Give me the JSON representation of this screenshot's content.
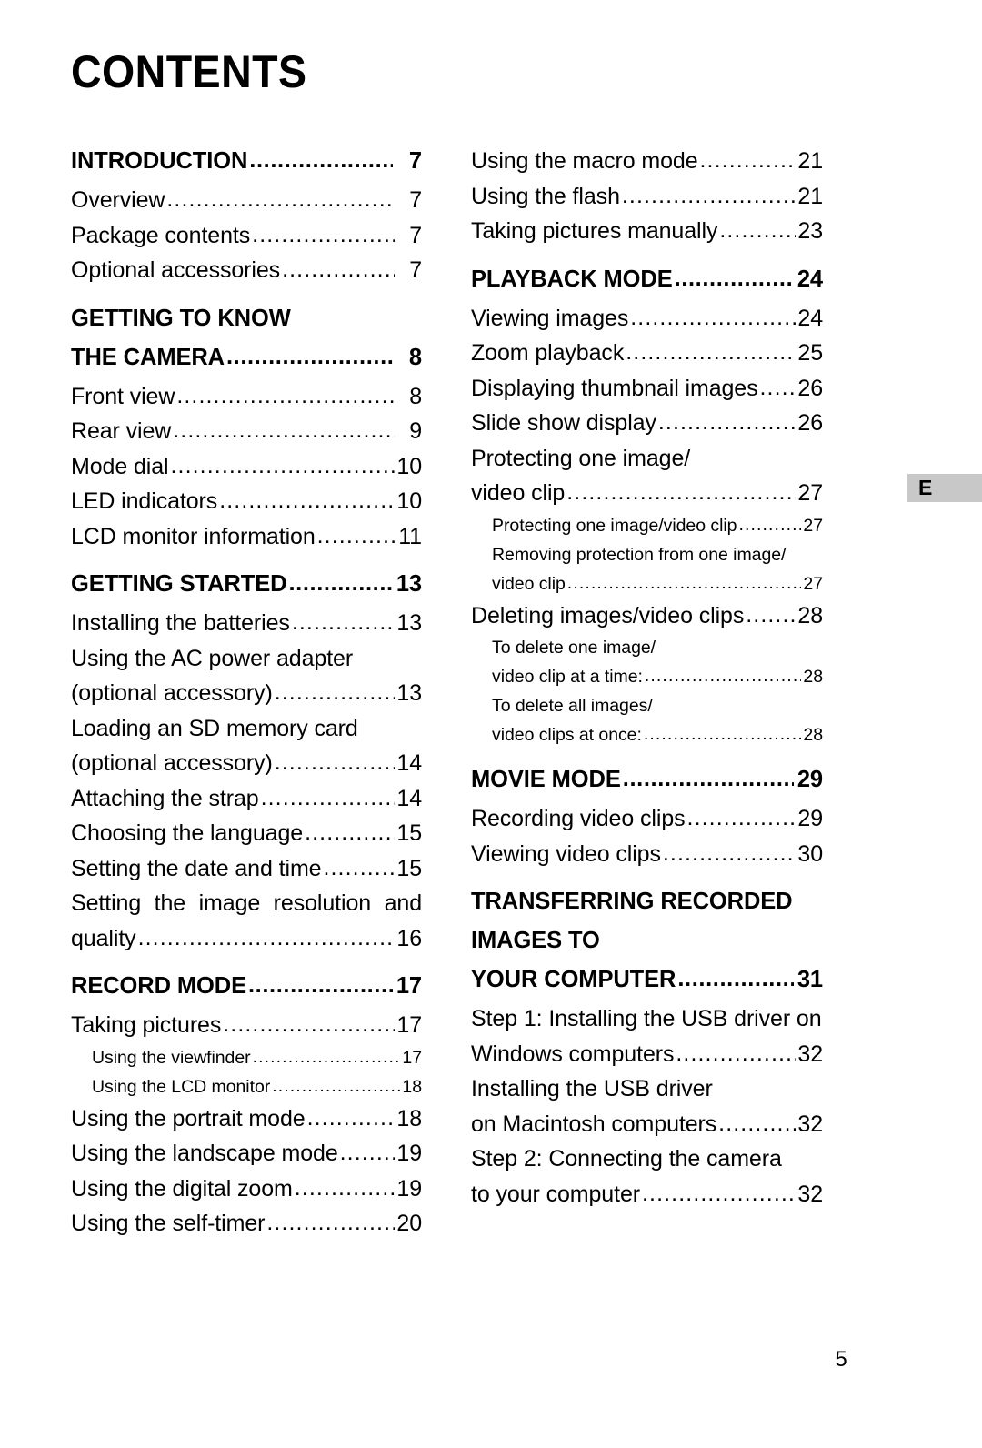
{
  "document": {
    "title": "CONTENTS",
    "folio": "5",
    "edge_tab_letter": "E",
    "leader_char": "."
  },
  "columns": [
    {
      "name": "left",
      "entries": [
        {
          "level": "head",
          "lines": [
            {
              "text": "INTRODUCTION",
              "page": "7"
            }
          ],
          "gap": "none"
        },
        {
          "level": "item",
          "lines": [
            {
              "text": "Overview",
              "page": "7"
            }
          ],
          "gap": "none"
        },
        {
          "level": "item",
          "lines": [
            {
              "text": "Package contents",
              "page": "7"
            }
          ],
          "gap": "none"
        },
        {
          "level": "item",
          "lines": [
            {
              "text": "Optional accessories",
              "page": "7"
            }
          ],
          "gap": "none"
        },
        {
          "level": "head",
          "lines": [
            {
              "text": "GETTING TO KNOW",
              "page": ""
            },
            {
              "text": "THE CAMERA",
              "page": "8"
            }
          ],
          "gap": "before"
        },
        {
          "level": "item",
          "lines": [
            {
              "text": "Front view",
              "page": "8"
            }
          ],
          "gap": "none"
        },
        {
          "level": "item",
          "lines": [
            {
              "text": "Rear view",
              "page": "9"
            }
          ],
          "gap": "none"
        },
        {
          "level": "item",
          "lines": [
            {
              "text": "Mode dial",
              "page": "10"
            }
          ],
          "gap": "none"
        },
        {
          "level": "item",
          "lines": [
            {
              "text": "LED indicators",
              "page": "10"
            }
          ],
          "gap": "none"
        },
        {
          "level": "item",
          "lines": [
            {
              "text": "LCD monitor information",
              "page": "11"
            }
          ],
          "gap": "none"
        },
        {
          "level": "head",
          "lines": [
            {
              "text": "GETTING STARTED",
              "page": "13"
            }
          ],
          "gap": "before"
        },
        {
          "level": "item",
          "lines": [
            {
              "text": "Installing the batteries",
              "page": "13"
            }
          ],
          "gap": "none"
        },
        {
          "level": "item",
          "lines": [
            {
              "text": "Using the AC power adapter",
              "page": ""
            },
            {
              "text": "(optional accessory)",
              "page": "13"
            }
          ],
          "gap": "none"
        },
        {
          "level": "item",
          "lines": [
            {
              "text": "Loading an SD memory card",
              "page": ""
            },
            {
              "text": "(optional accessory)",
              "page": "14"
            }
          ],
          "gap": "none"
        },
        {
          "level": "item",
          "lines": [
            {
              "text": "Attaching the strap",
              "page": "14"
            }
          ],
          "gap": "none"
        },
        {
          "level": "item",
          "lines": [
            {
              "text": "Choosing the language",
              "page": "15"
            }
          ],
          "gap": "none"
        },
        {
          "level": "item",
          "lines": [
            {
              "text": "Setting the date and time",
              "page": "15"
            }
          ],
          "gap": "none"
        },
        {
          "level": "item",
          "lines": [
            {
              "text": "Setting the image resolution and",
              "page": "",
              "justify": true
            },
            {
              "text": "quality",
              "page": "16"
            }
          ],
          "gap": "none"
        },
        {
          "level": "head",
          "lines": [
            {
              "text": "RECORD MODE",
              "page": "17"
            }
          ],
          "gap": "before"
        },
        {
          "level": "item",
          "lines": [
            {
              "text": "Taking pictures",
              "page": "17"
            }
          ],
          "gap": "none"
        },
        {
          "level": "sub",
          "lines": [
            {
              "text": "Using the viewfinder",
              "page": "17"
            }
          ],
          "gap": "none"
        },
        {
          "level": "sub",
          "lines": [
            {
              "text": "Using the LCD monitor",
              "page": "18"
            }
          ],
          "gap": "none"
        },
        {
          "level": "item",
          "lines": [
            {
              "text": "Using the portrait mode",
              "page": "18"
            }
          ],
          "gap": "none"
        },
        {
          "level": "item",
          "lines": [
            {
              "text": "Using the landscape mode",
              "page": "19"
            }
          ],
          "gap": "none"
        },
        {
          "level": "item",
          "lines": [
            {
              "text": "Using the digital zoom",
              "page": "19"
            }
          ],
          "gap": "none"
        },
        {
          "level": "item",
          "lines": [
            {
              "text": "Using the self-timer",
              "page": "20"
            }
          ],
          "gap": "none"
        }
      ]
    },
    {
      "name": "right",
      "entries": [
        {
          "level": "item",
          "lines": [
            {
              "text": "Using the macro mode",
              "page": "21"
            }
          ],
          "gap": "none"
        },
        {
          "level": "item",
          "lines": [
            {
              "text": "Using the flash",
              "page": "21"
            }
          ],
          "gap": "none"
        },
        {
          "level": "item",
          "lines": [
            {
              "text": "Taking pictures manually",
              "page": "23"
            }
          ],
          "gap": "none"
        },
        {
          "level": "head",
          "lines": [
            {
              "text": "PLAYBACK MODE",
              "page": "24"
            }
          ],
          "gap": "before"
        },
        {
          "level": "item",
          "lines": [
            {
              "text": "Viewing images",
              "page": "24"
            }
          ],
          "gap": "none"
        },
        {
          "level": "item",
          "lines": [
            {
              "text": "Zoom playback",
              "page": "25"
            }
          ],
          "gap": "none"
        },
        {
          "level": "item",
          "lines": [
            {
              "text": "Displaying thumbnail images",
              "page": "26"
            }
          ],
          "gap": "none"
        },
        {
          "level": "item",
          "lines": [
            {
              "text": "Slide show display",
              "page": "26"
            }
          ],
          "gap": "none"
        },
        {
          "level": "item",
          "lines": [
            {
              "text": "Protecting one image/",
              "page": ""
            },
            {
              "text": "video clip",
              "page": "27"
            }
          ],
          "gap": "none"
        },
        {
          "level": "sub",
          "lines": [
            {
              "text": "Protecting one image/video clip",
              "page": "27"
            }
          ],
          "gap": "none"
        },
        {
          "level": "sub",
          "lines": [
            {
              "text": "Removing protection from one image/",
              "page": ""
            },
            {
              "text": "video clip",
              "page": "27"
            }
          ],
          "gap": "none"
        },
        {
          "level": "item",
          "lines": [
            {
              "text": "Deleting images/video clips",
              "page": "28"
            }
          ],
          "gap": "none"
        },
        {
          "level": "sub",
          "lines": [
            {
              "text": "To delete one image/",
              "page": ""
            },
            {
              "text": "video clip at a time:",
              "page": "28"
            }
          ],
          "gap": "none"
        },
        {
          "level": "sub",
          "lines": [
            {
              "text": "To delete all images/",
              "page": ""
            },
            {
              "text": "video clips at once:",
              "page": "28"
            }
          ],
          "gap": "none"
        },
        {
          "level": "head",
          "lines": [
            {
              "text": "MOVIE MODE",
              "page": "29"
            }
          ],
          "gap": "before"
        },
        {
          "level": "item",
          "lines": [
            {
              "text": "Recording video clips",
              "page": "29"
            }
          ],
          "gap": "none"
        },
        {
          "level": "item",
          "lines": [
            {
              "text": "Viewing video clips",
              "page": "30"
            }
          ],
          "gap": "none"
        },
        {
          "level": "head",
          "lines": [
            {
              "text": "TRANSFERRING RECORDED",
              "page": ""
            },
            {
              "text": "IMAGES TO",
              "page": ""
            },
            {
              "text": "YOUR COMPUTER",
              "page": "31"
            }
          ],
          "gap": "before"
        },
        {
          "level": "item",
          "lines": [
            {
              "text": "Step 1: Installing the USB driver on",
              "page": ""
            },
            {
              "text": "Windows computers",
              "page": "32"
            }
          ],
          "gap": "none"
        },
        {
          "level": "item",
          "lines": [
            {
              "text": "Installing the USB driver",
              "page": ""
            },
            {
              "text": "on Macintosh computers",
              "page": "32"
            }
          ],
          "gap": "none"
        },
        {
          "level": "item",
          "lines": [
            {
              "text": "Step 2: Connecting the camera",
              "page": ""
            },
            {
              "text": "to your computer",
              "page": "32"
            }
          ],
          "gap": "none"
        }
      ]
    }
  ]
}
